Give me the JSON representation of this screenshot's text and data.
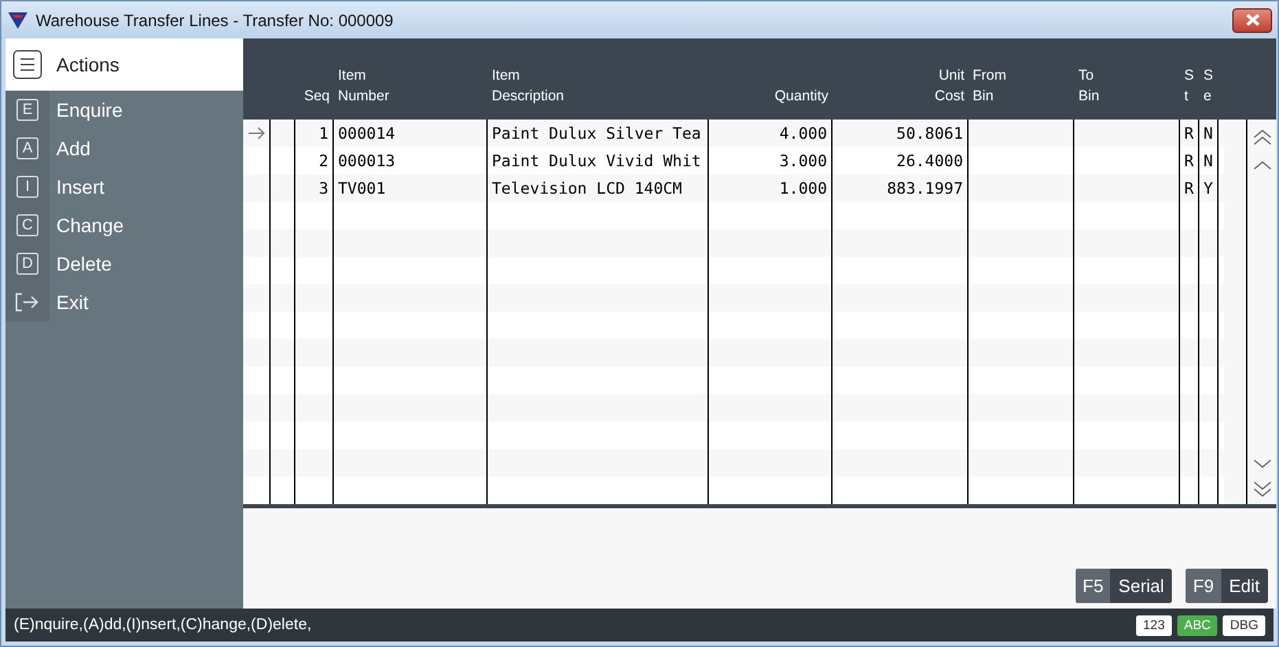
{
  "window": {
    "title": "Warehouse Transfer Lines - Transfer No: 000009"
  },
  "sidebar": {
    "title": "Actions",
    "items": [
      {
        "kind": "key",
        "key": "E",
        "label": "Enquire"
      },
      {
        "kind": "key",
        "key": "A",
        "label": "Add"
      },
      {
        "kind": "key",
        "key": "I",
        "label": "Insert"
      },
      {
        "kind": "key",
        "key": "C",
        "label": "Change"
      },
      {
        "kind": "key",
        "key": "D",
        "label": "Delete"
      },
      {
        "kind": "exit",
        "label": "Exit"
      }
    ]
  },
  "table": {
    "columns": [
      {
        "line2": "Seq"
      },
      {
        "line1": "Item",
        "line2": "Number"
      },
      {
        "line1": "Item",
        "line2": "Description"
      },
      {
        "line2": "Quantity"
      },
      {
        "line1": "Unit",
        "line2": "Cost"
      },
      {
        "line1": "From",
        "line2": "Bin"
      },
      {
        "line1": "To",
        "line2": "Bin"
      },
      {
        "line1": "S",
        "line2": "t"
      },
      {
        "line1": "S",
        "line2": "e"
      }
    ],
    "rows": [
      {
        "current": true,
        "cells": [
          "1",
          "000014",
          "Paint Dulux Silver Tea",
          "4.000",
          "50.8061",
          "",
          "",
          "R",
          "N"
        ]
      },
      {
        "current": false,
        "cells": [
          "2",
          "000013",
          "Paint Dulux Vivid Whit",
          "3.000",
          "26.4000",
          "",
          "",
          "R",
          "N"
        ]
      },
      {
        "current": false,
        "cells": [
          "3",
          "TV001",
          "Television LCD 140CM",
          "1.000",
          "883.1997",
          "",
          "",
          "R",
          "Y"
        ]
      }
    ]
  },
  "buttons": [
    {
      "key": "F5",
      "label": "Serial"
    },
    {
      "key": "F9",
      "label": "Edit"
    }
  ],
  "status_bar": {
    "text": "(E)nquire,(A)dd,(I)nsert,(C)hange,(D)elete,",
    "badges": [
      {
        "label": "123",
        "active": false
      },
      {
        "label": "ABC",
        "active": true
      },
      {
        "label": "DBG",
        "active": false
      }
    ]
  }
}
